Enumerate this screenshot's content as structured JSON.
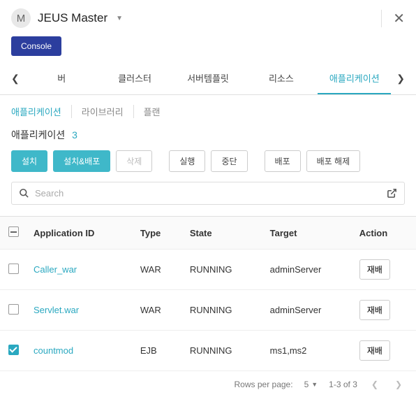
{
  "header": {
    "avatar_letter": "M",
    "title": "JEUS Master"
  },
  "console_btn": "Console",
  "nav": {
    "tabs": [
      "버",
      "클러스터",
      "서버템플릿",
      "리소스",
      "애플리케이션"
    ],
    "active_index": 4
  },
  "sub_tabs": {
    "items": [
      "애플리케이션",
      "라이브러리",
      "플랜"
    ],
    "active_index": 0
  },
  "section": {
    "title": "애플리케이션",
    "count": "3"
  },
  "actions": {
    "install": "설치",
    "install_deploy": "설치&배포",
    "delete": "삭제",
    "run": "실행",
    "stop": "중단",
    "deploy": "배포",
    "undeploy": "배포 해제"
  },
  "search": {
    "placeholder": "Search"
  },
  "table": {
    "headers": {
      "app_id": "Application ID",
      "type": "Type",
      "state": "State",
      "target": "Target",
      "action": "Action"
    },
    "rows": [
      {
        "checked": false,
        "app_id": "Caller_war",
        "type": "WAR",
        "state": "RUNNING",
        "target": "adminServer",
        "action": "재배"
      },
      {
        "checked": false,
        "app_id": "Servlet.war",
        "type": "WAR",
        "state": "RUNNING",
        "target": "adminServer",
        "action": "재배"
      },
      {
        "checked": true,
        "app_id": "countmod",
        "type": "EJB",
        "state": "RUNNING",
        "target": "ms1,ms2",
        "action": "재배"
      }
    ]
  },
  "pager": {
    "rows_per_page_label": "Rows per page:",
    "page_size": "5",
    "range": "1-3 of 3"
  }
}
